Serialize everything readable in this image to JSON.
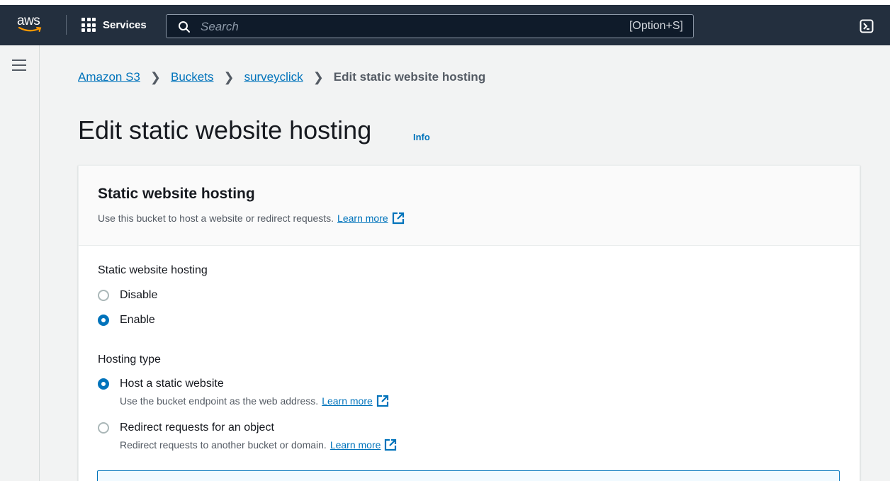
{
  "nav": {
    "logo_text": "aws",
    "services_label": "Services",
    "search_placeholder": "Search",
    "search_shortcut": "[Option+S]"
  },
  "breadcrumb": {
    "items": [
      "Amazon S3",
      "Buckets",
      "surveyclick"
    ],
    "current": "Edit static website hosting"
  },
  "page": {
    "title": "Edit static website hosting",
    "info_label": "Info"
  },
  "card": {
    "title": "Static website hosting",
    "description": "Use this bucket to host a website or redirect requests.",
    "learn_more": "Learn more",
    "hosting_label": "Static website hosting",
    "hosting_options": [
      {
        "label": "Disable",
        "selected": false
      },
      {
        "label": "Enable",
        "selected": true
      }
    ],
    "type_label": "Hosting type",
    "type_options": [
      {
        "label": "Host a static website",
        "description": "Use the bucket endpoint as the web address.",
        "learn_more": "Learn more",
        "selected": true
      },
      {
        "label": "Redirect requests for an object",
        "description": "Redirect requests to another bucket or domain.",
        "learn_more": "Learn more",
        "selected": false
      }
    ]
  },
  "colors": {
    "nav_bg": "#232f3e",
    "link": "#0073bb",
    "aws_orange": "#ff9900"
  },
  "icons": [
    "aws-smile-icon",
    "services-grid-icon",
    "search-icon",
    "cloudshell-icon",
    "hamburger-icon",
    "external-link-icon"
  ]
}
